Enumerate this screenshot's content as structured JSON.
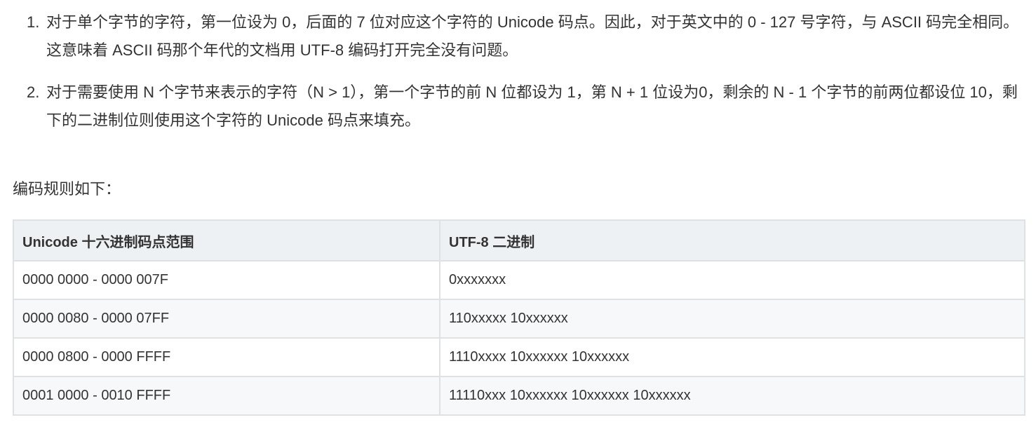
{
  "rules": [
    {
      "number": "1.",
      "text": "对于单个字节的字符，第一位设为 0，后面的 7 位对应这个字符的 Unicode 码点。因此，对于英文中的 0 - 127 号字符，与 ASCII 码完全相同。这意味着 ASCII 码那个年代的文档用 UTF-8 编码打开完全没有问题。"
    },
    {
      "number": "2.",
      "text": "对于需要使用 N 个字节来表示的字符（N > 1），第一个字节的前 N 位都设为 1，第 N + 1 位设为0，剩余的 N - 1 个字节的前两位都设位 10，剩下的二进制位则使用这个字符的 Unicode 码点来填充。"
    }
  ],
  "intro": "编码规则如下：",
  "table": {
    "headers": [
      "Unicode 十六进制码点范围",
      "UTF-8 二进制"
    ],
    "rows": [
      [
        "0000 0000 - 0000 007F",
        "0xxxxxxx"
      ],
      [
        "0000 0080 - 0000 07FF",
        "110xxxxx 10xxxxxx"
      ],
      [
        "0000 0800 - 0000 FFFF",
        "1110xxxx 10xxxxxx 10xxxxxx"
      ],
      [
        "0001 0000 - 0010 FFFF",
        "11110xxx 10xxxxxx 10xxxxxx 10xxxxxx"
      ]
    ]
  }
}
